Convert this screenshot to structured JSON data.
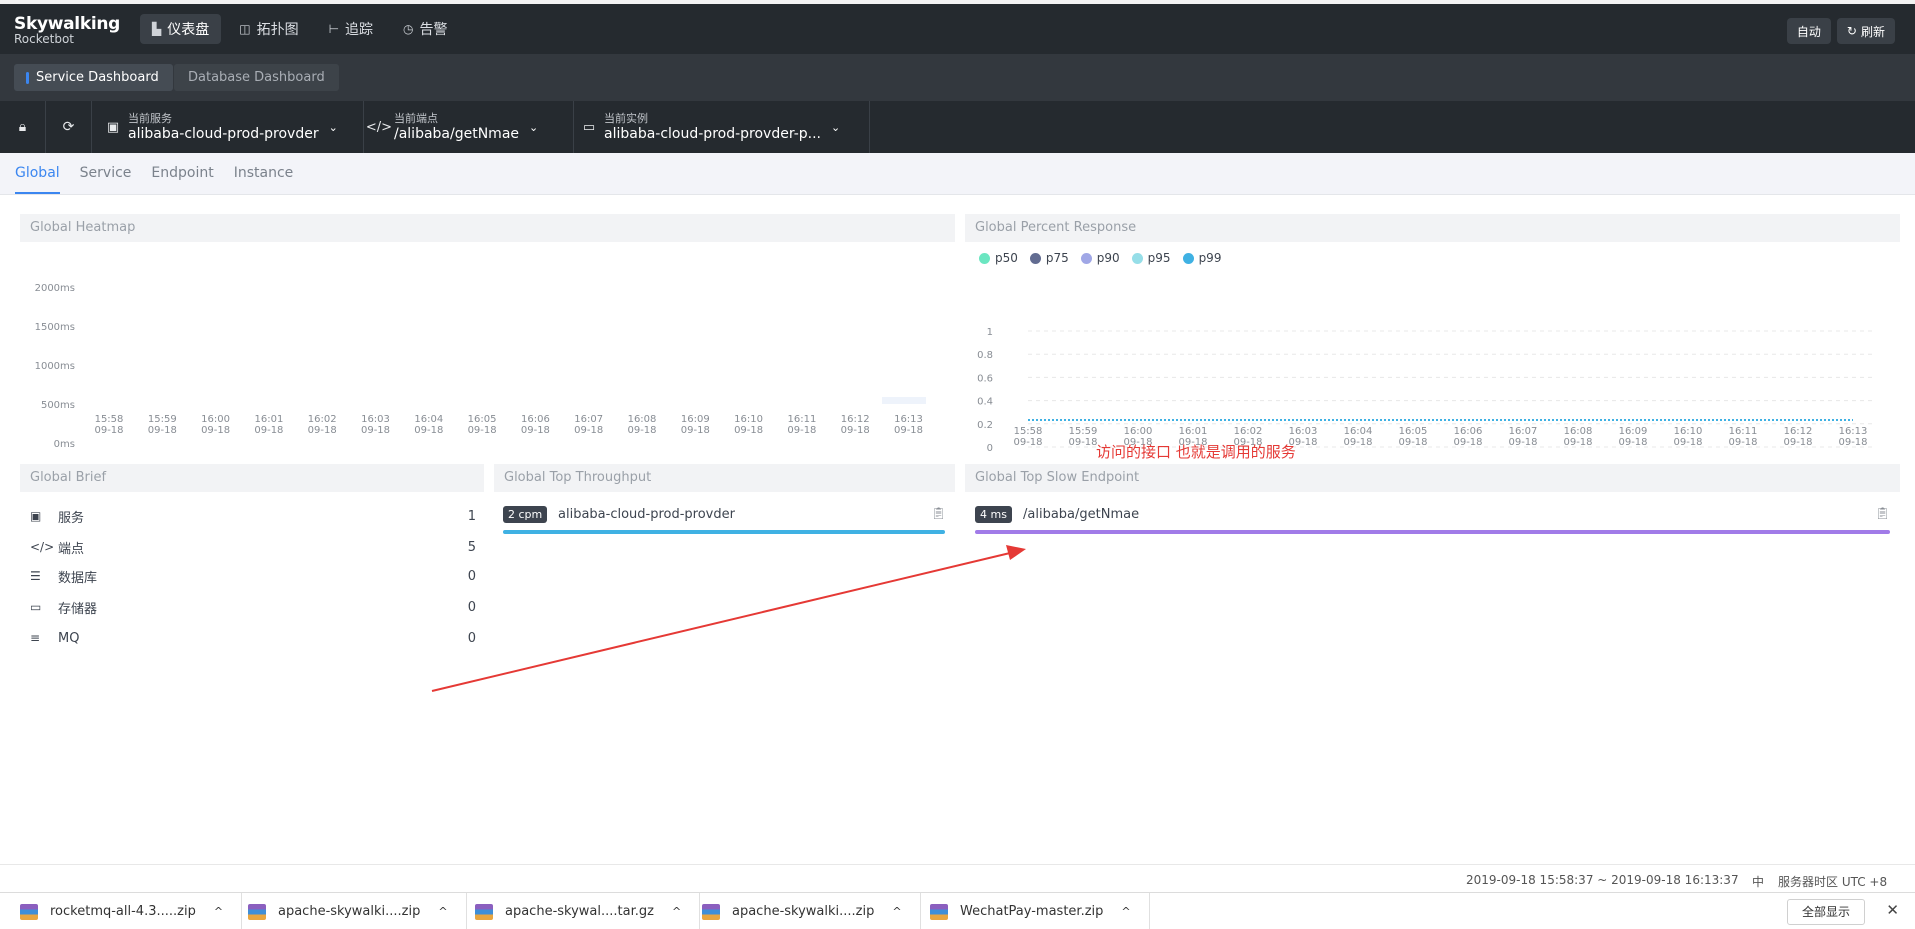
{
  "logo": {
    "line1": "Skywalking",
    "line2": "Rocketbot"
  },
  "nav": [
    {
      "label": "仪表盘",
      "icon": "chart-icon",
      "active": true
    },
    {
      "label": "拓扑图",
      "icon": "topology-icon",
      "active": false
    },
    {
      "label": "追踪",
      "icon": "trace-icon",
      "active": false
    },
    {
      "label": "告警",
      "icon": "alarm-icon",
      "active": false
    }
  ],
  "top_right": {
    "auto": "自动",
    "refresh": "刷新"
  },
  "dashboards": {
    "active": "Service Dashboard",
    "inactive": "Database Dashboard"
  },
  "selectors": {
    "service": {
      "label": "当前服务",
      "value": "alibaba-cloud-prod-provder"
    },
    "endpoint": {
      "label": "当前端点",
      "value": "/alibaba/getNmae"
    },
    "instance": {
      "label": "当前实例",
      "value": "alibaba-cloud-prod-provder-p..."
    }
  },
  "subtabs": [
    "Global",
    "Service",
    "Endpoint",
    "Instance"
  ],
  "panels": {
    "heatmap": "Global Heatmap",
    "percent": "Global Percent Response",
    "brief": "Global Brief",
    "throughput": "Global Top Throughput",
    "slow": "Global Top Slow Endpoint"
  },
  "time_ticks": [
    "15:58",
    "15:59",
    "16:00",
    "16:01",
    "16:02",
    "16:03",
    "16:04",
    "16:05",
    "16:06",
    "16:07",
    "16:08",
    "16:09",
    "16:10",
    "16:11",
    "16:12",
    "16:13"
  ],
  "date_tick": "09-18",
  "heatmap_y": [
    "2000ms",
    "1500ms",
    "1000ms",
    "500ms",
    "0ms"
  ],
  "percent_y": [
    "1",
    "0.8",
    "0.6",
    "0.4",
    "0.2",
    "0"
  ],
  "legend": [
    {
      "name": "p50",
      "color": "#6be6c1"
    },
    {
      "name": "p75",
      "color": "#626c91"
    },
    {
      "name": "p90",
      "color": "#a0a7e6"
    },
    {
      "name": "p95",
      "color": "#96dee8"
    },
    {
      "name": "p99",
      "color": "#3fb1e3"
    }
  ],
  "brief": [
    {
      "label": "服务",
      "value": "1",
      "icon": "lock-icon"
    },
    {
      "label": "端点",
      "value": "5",
      "icon": "code-icon"
    },
    {
      "label": "数据库",
      "value": "0",
      "icon": "database-icon"
    },
    {
      "label": "存储器",
      "value": "0",
      "icon": "storage-icon"
    },
    {
      "label": "MQ",
      "value": "0",
      "icon": "mq-icon"
    }
  ],
  "throughput": {
    "badge": "2 cpm",
    "name": "alibaba-cloud-prod-provder",
    "color": "#3fb1e3"
  },
  "slow": {
    "badge": "4 ms",
    "name": "/alibaba/getNmae",
    "color": "#a17be8"
  },
  "annotation": "访问的接口 也就是调用的服务",
  "footer": {
    "range": "2019-09-18 15:58:37 ~ 2019-09-18 16:13:37",
    "lang": "中",
    "tz": "服务器时区 UTC +8"
  },
  "downloads": [
    "rocketmq-all-4.3.....zip",
    "apache-skywalki....zip",
    "apache-skywal....tar.gz",
    "apache-skywalki....zip",
    "WechatPay-master.zip"
  ],
  "downloads_show_all": "全部显示"
}
